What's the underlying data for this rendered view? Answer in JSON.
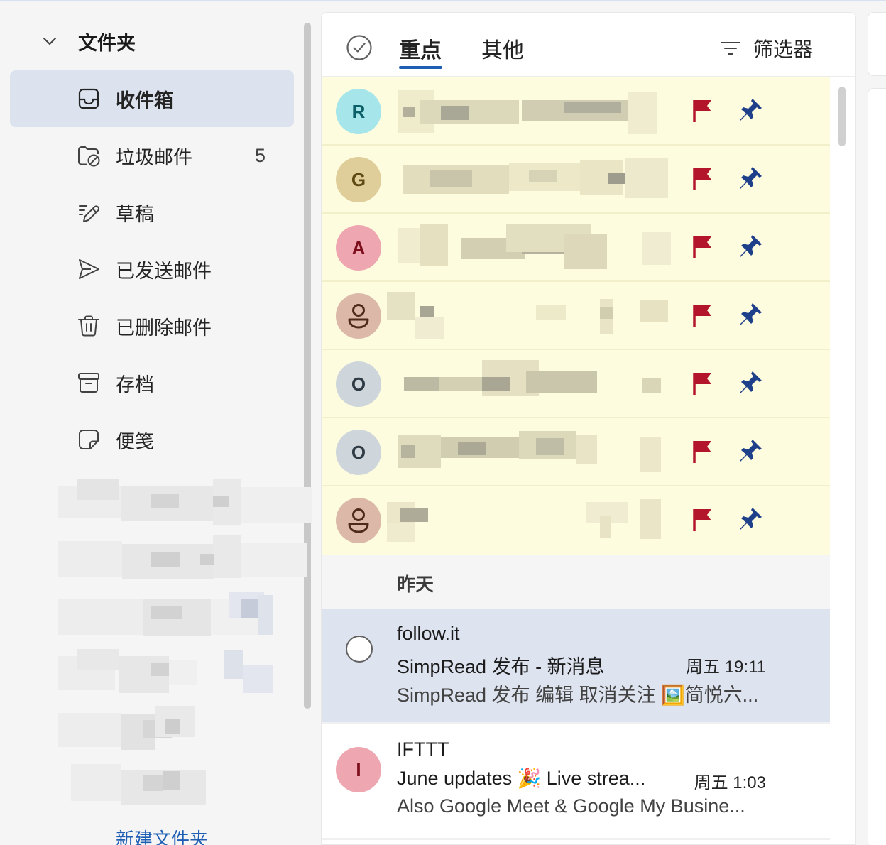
{
  "sidebar": {
    "header": "文件夹",
    "items": [
      {
        "label": "收件箱",
        "count": "",
        "icon": "inbox-icon",
        "selected": true
      },
      {
        "label": "垃圾邮件",
        "count": "5",
        "icon": "junk-icon",
        "selected": false
      },
      {
        "label": "草稿",
        "count": "",
        "icon": "drafts-icon",
        "selected": false
      },
      {
        "label": "已发送邮件",
        "count": "",
        "icon": "send-icon",
        "selected": false
      },
      {
        "label": "已删除邮件",
        "count": "",
        "icon": "trash-icon",
        "selected": false
      },
      {
        "label": "存档",
        "count": "",
        "icon": "archive-icon",
        "selected": false
      },
      {
        "label": "便笺",
        "count": "",
        "icon": "note-icon",
        "selected": false
      }
    ],
    "new_folder": "新建文件夹"
  },
  "mail_list": {
    "tabs": [
      {
        "label": "重点",
        "active": true
      },
      {
        "label": "其他",
        "active": false
      }
    ],
    "filter_label": "筛选器",
    "pinned": [
      {
        "initial": "R",
        "avatar_bg": "#a6e5ea",
        "avatar_fg": "#0b5f66"
      },
      {
        "initial": "G",
        "avatar_bg": "#dfcd9a",
        "avatar_fg": "#5e4a12"
      },
      {
        "initial": "A",
        "avatar_bg": "#eea7b1",
        "avatar_fg": "#7d0f1c"
      },
      {
        "initial": "",
        "avatar_bg": "#dcb8a8",
        "avatar_fg": "#4e2a1c"
      },
      {
        "initial": "O",
        "avatar_bg": "#ced6dc",
        "avatar_fg": "#2e3a44"
      },
      {
        "initial": "O",
        "avatar_bg": "#ced6dc",
        "avatar_fg": "#2e3a44"
      },
      {
        "initial": "",
        "avatar_bg": "#dcb8a8",
        "avatar_fg": "#4e2a1c"
      }
    ],
    "date_group": "昨天",
    "messages": [
      {
        "sender": "follow.it",
        "subject": "SimpRead 发布 - 新消息",
        "time": "周五 19:11",
        "preview": "SimpRead 发布 编辑 取消关注 🖼️简悦六...",
        "selected": true,
        "initial": ""
      },
      {
        "sender": "IFTTT",
        "subject": "June updates 🎉 Live strea...",
        "time": "周五 1:03",
        "preview": "Also Google Meet & Google My Busine...",
        "selected": false,
        "initial": "I",
        "avatar_bg": "#eea7b1",
        "avatar_fg": "#7d0f1c"
      }
    ]
  },
  "colors": {
    "accent": "#1f5fb3",
    "flag": "#b3152a",
    "pin": "#1e3f8a",
    "pinned_bg": "#fefcdf",
    "selected_bg": "#dde3ef"
  }
}
